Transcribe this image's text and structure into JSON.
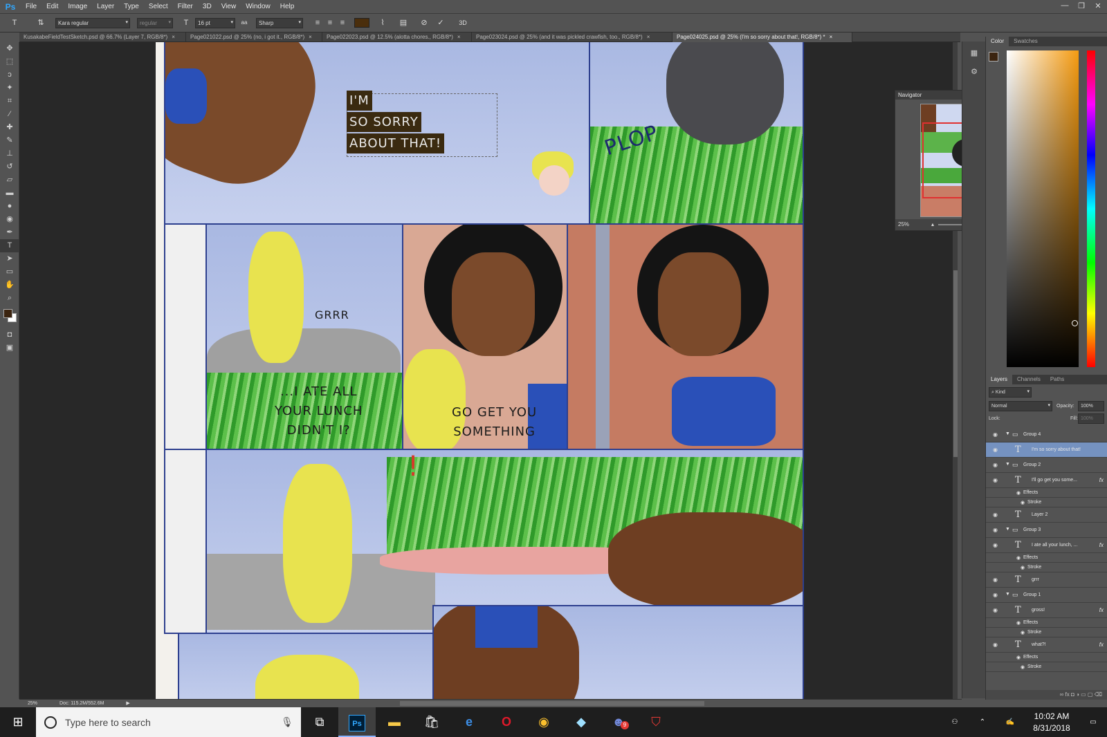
{
  "app": {
    "logo": "Ps"
  },
  "menu": [
    "File",
    "Edit",
    "Image",
    "Layer",
    "Type",
    "Select",
    "Filter",
    "3D",
    "View",
    "Window",
    "Help"
  ],
  "window_controls": [
    "—",
    "❐",
    "✕"
  ],
  "options": {
    "font_family": "Kara regular",
    "font_style": "regular",
    "font_size": "16 pt",
    "aa_label": "aa",
    "antialias": "Sharp",
    "three_d": "3D",
    "text_color": "#4a2e0c"
  },
  "tabs": [
    {
      "label": "KusakabeFieldTestSketch.psd @ 66.7% (Layer 7, RGB/8*)",
      "close": "×"
    },
    {
      "label": "Page021022.psd @ 25% (no, i got it., RGB/8*)",
      "close": "×"
    },
    {
      "label": "Page022023.psd @ 12.5% (alotta chores., RGB/8*)",
      "close": "×"
    },
    {
      "label": "Page023024.psd @ 25% (and  it was  pickled  crawfish,  too., RGB/8*)",
      "close": "×"
    },
    {
      "label": "Page024025.psd @ 25% (I'm so sorry about that!, RGB/8*) *",
      "close": "×"
    }
  ],
  "tools": [
    "move-icon",
    "marquee-icon",
    "lasso-icon",
    "magic-wand-icon",
    "crop-icon",
    "eyedropper-icon",
    "healing-icon",
    "brush-icon",
    "stamp-icon",
    "history-brush-icon",
    "eraser-icon",
    "gradient-icon",
    "blur-icon",
    "dodge-icon",
    "pen-icon",
    "type-icon",
    "path-select-icon",
    "shape-icon",
    "hand-icon",
    "zoom-icon"
  ],
  "colors": {
    "foreground": "#3b2410",
    "background": "#ffffff",
    "selected_layer": "#7592c0"
  },
  "comic": {
    "sorry_lines": [
      "I'M",
      "SO SORRY",
      "ABOUT THAT!"
    ],
    "plop": "PLOP",
    "grrr": "GRRR",
    "ate_lunch": [
      "...I ATE ALL",
      "YOUR LUNCH",
      "DIDN'T I?"
    ],
    "go_get": [
      "GO GET YOU",
      "SOMETHING"
    ],
    "exclaim": "!"
  },
  "navigator": {
    "title": "Navigator",
    "zoom": "25%"
  },
  "color_panel": {
    "tabs": [
      "Color",
      "Swatches"
    ]
  },
  "layers_panel": {
    "tabs": [
      "Layers",
      "Channels",
      "Paths"
    ],
    "kind": "Kind",
    "blend": "Normal",
    "opacity_label": "Opacity:",
    "opacity": "100%",
    "lock_label": "Lock:",
    "fill_label": "Fill:",
    "fill": "100%",
    "layers": [
      {
        "name": "Group 4",
        "type": "group"
      },
      {
        "name": "I'm so sorry about that!",
        "type": "text",
        "selected": true
      },
      {
        "name": "Group 2",
        "type": "group"
      },
      {
        "name": "I'll go get you some...",
        "type": "text",
        "fx": "fx"
      },
      {
        "name": "Effects",
        "type": "effect"
      },
      {
        "name": "Stroke",
        "type": "effect2"
      },
      {
        "name": "Layer 2",
        "type": "text"
      },
      {
        "name": "Group 3",
        "type": "group"
      },
      {
        "name": "I ate all your lunch, ...",
        "type": "text",
        "fx": "fx"
      },
      {
        "name": "Effects",
        "type": "effect"
      },
      {
        "name": "Stroke",
        "type": "effect2"
      },
      {
        "name": "grrr",
        "type": "text"
      },
      {
        "name": "Group 1",
        "type": "group"
      },
      {
        "name": "gross!",
        "type": "text",
        "fx": "fx"
      },
      {
        "name": "Effects",
        "type": "effect"
      },
      {
        "name": "Stroke",
        "type": "effect2"
      },
      {
        "name": "what?!",
        "type": "text",
        "fx": "fx"
      },
      {
        "name": "Effects",
        "type": "effect"
      },
      {
        "name": "Stroke",
        "type": "effect2"
      }
    ]
  },
  "status": {
    "zoom": "25%",
    "doc": "Doc: 115.2M/552.6M"
  },
  "taskbar": {
    "search_placeholder": "Type here to search",
    "apps": [
      "task-view-icon",
      "photoshop-icon",
      "file-explorer-icon",
      "store-icon",
      "edge-icon",
      "opera-icon",
      "chrome-icon",
      "app-icon",
      "discord-icon",
      "shield-app-icon"
    ],
    "ps_label": "Ps",
    "discord_badge": "9",
    "time": "10:02 AM",
    "date": "8/31/2018"
  }
}
